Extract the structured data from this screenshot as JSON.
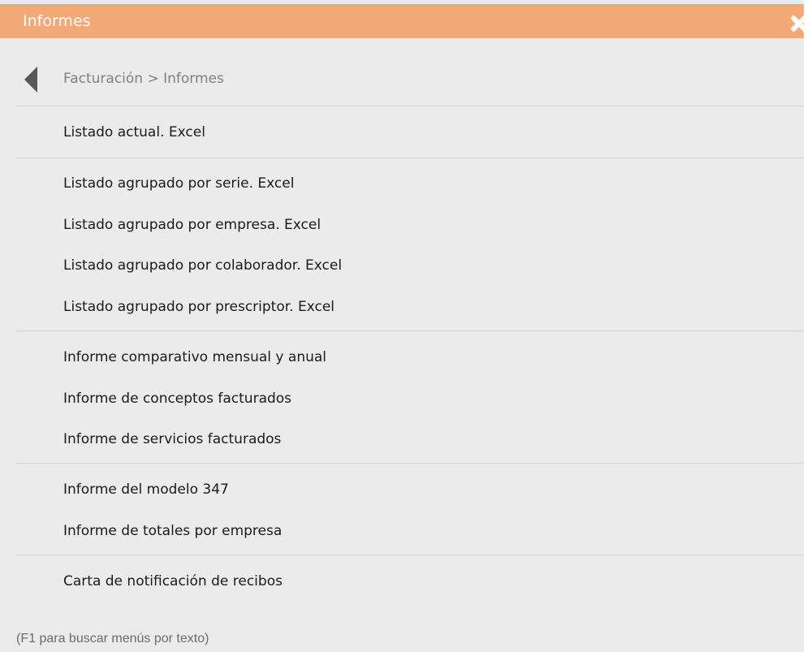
{
  "window": {
    "title": "Informes",
    "close_icon": "close-icon"
  },
  "breadcrumb": {
    "back_icon": "back-arrow-icon",
    "text": "Facturación > Informes"
  },
  "groups": [
    {
      "items": [
        {
          "label": "Listado actual. Excel"
        }
      ]
    },
    {
      "items": [
        {
          "label": "Listado agrupado por serie. Excel"
        },
        {
          "label": "Listado agrupado por empresa. Excel"
        },
        {
          "label": "Listado agrupado por colaborador. Excel"
        },
        {
          "label": "Listado agrupado por prescriptor. Excel"
        }
      ]
    },
    {
      "items": [
        {
          "label": "Informe comparativo mensual y anual"
        },
        {
          "label": "Informe de conceptos facturados"
        },
        {
          "label": "Informe de servicios facturados"
        }
      ]
    },
    {
      "items": [
        {
          "label": "Informe del modelo 347"
        },
        {
          "label": "Informe de totales por empresa"
        }
      ]
    },
    {
      "items": [
        {
          "label": "Carta de notificación de recibos"
        }
      ]
    }
  ],
  "footer": {
    "hint": "(F1 para buscar menús por texto)"
  },
  "colors": {
    "titlebar": "#f3a977",
    "panel_background": "#ebebeb",
    "divider": "#d2d2d2"
  }
}
